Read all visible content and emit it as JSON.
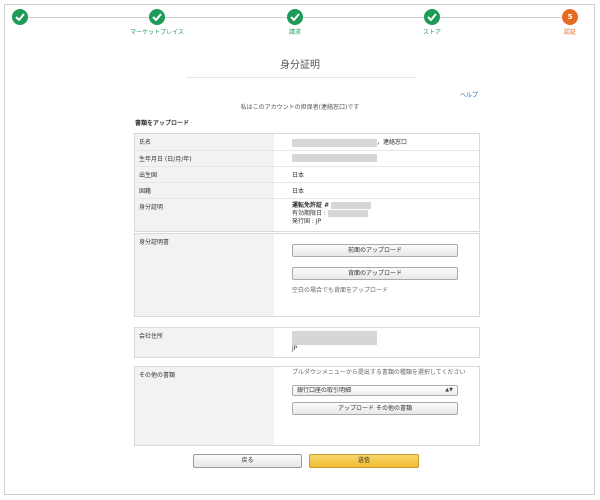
{
  "stepper": {
    "steps": [
      {
        "label": "",
        "state": "done"
      },
      {
        "label": "マーケットプレイス",
        "state": "done"
      },
      {
        "label": "請求",
        "state": "done"
      },
      {
        "label": "ストア",
        "state": "done"
      },
      {
        "label": "認証",
        "state": "active",
        "number": "5"
      }
    ]
  },
  "page": {
    "title": "身分証明",
    "help": "ヘルプ",
    "subtitle": "私はこのアカウントの担保者(連絡窓口)です",
    "section_title": "書類をアップロード"
  },
  "info_table": {
    "rows": [
      {
        "label": "氏名",
        "value": "，連絡窓口"
      },
      {
        "label": "生年月日 (日/月/年)",
        "value": ""
      },
      {
        "label": "出生国",
        "value": "日本"
      },
      {
        "label": "国籍",
        "value": "日本"
      },
      {
        "label": "身分証明",
        "doc_type": "運転免許証 #",
        "expiry": "有効期限日 :",
        "issuer": "発行国 : JP"
      }
    ]
  },
  "id_upload": {
    "label": "身分証明書",
    "front_button": "前面のアップロード",
    "back_button": "背面のアップロード",
    "hint": "空白の場合でも背面をアップロード"
  },
  "address": {
    "label": "会社住所",
    "country": "JP"
  },
  "other_docs": {
    "label": "その他の書類",
    "instruction": "プルダウンメニューから提出する書類の種類を選択してください",
    "select_value": "銀行口座の取引明細",
    "upload_button": "アップロード その他の書類"
  },
  "footer": {
    "back_label": "戻る",
    "submit_label": "送信"
  },
  "colors": {
    "step_done": "#1e9b58",
    "step_active": "#e46b21",
    "submit": "#f0bd33",
    "link": "#1a73c1"
  }
}
